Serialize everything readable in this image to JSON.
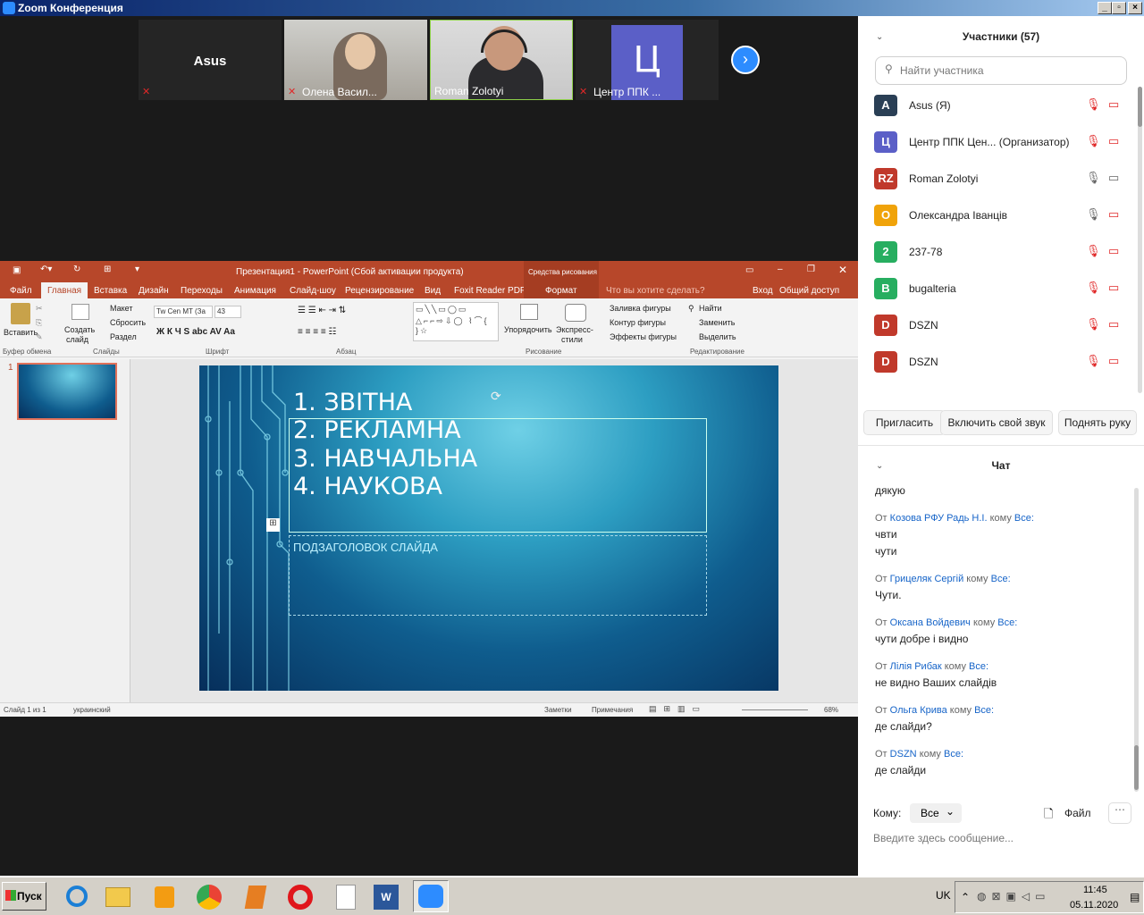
{
  "window": {
    "title": "Zoom Конференция"
  },
  "videos": [
    {
      "name": "Asus",
      "kind": "name-only"
    },
    {
      "name": "Олена Васил...",
      "kind": "camera"
    },
    {
      "name": "Roman Zolotyi",
      "kind": "camera"
    },
    {
      "name": "Центр ППК ...",
      "kind": "avatar",
      "avatar": "Ц"
    }
  ],
  "ppt": {
    "title": "Презентация1 - PowerPoint (Сбой активации продукта)",
    "context_tab": "Средства рисования",
    "tabs": [
      "Файл",
      "Главная",
      "Вставка",
      "Дизайн",
      "Переходы",
      "Анимация",
      "Слайд-шоу",
      "Рецензирование",
      "Вид",
      "Foxit Reader PDF",
      "Формат"
    ],
    "tell_me": "Что вы хотите сделать?",
    "signin": "Вход",
    "share": "Общий доступ",
    "ribbon": {
      "paste": "Вставить",
      "new_slide": "Создать",
      "new_slide2": "слайд",
      "layout": "Макет",
      "reset": "Сбросить",
      "section": "Раздел",
      "font_name": "Tw Cen MT (За",
      "font_size": "43",
      "arrange": "Упорядочить",
      "quick_styles": "Экспресс-",
      "quick_styles2": "стили",
      "fill": "Заливка фигуры",
      "outline": "Контур фигуры",
      "effects": "Эффекты фигуры",
      "find": "Найти",
      "replace": "Заменить",
      "select": "Выделить",
      "groups": [
        "Буфер обмена",
        "Слайды",
        "Шрифт",
        "Абзац",
        "Рисование",
        "Редактирование"
      ]
    },
    "slide_lines": [
      "1. ЗВІТНА",
      "2. РЕКЛАМНА",
      "3. НАВЧАЛЬНА",
      "4. НАУКОВА"
    ],
    "subtitle": "ПОДЗАГОЛОВОК СЛАЙДА",
    "thumb_num": "1",
    "status": {
      "slide": "Слайд 1 из 1",
      "lang": "украинский",
      "notes": "Заметки",
      "comments": "Примечания",
      "zoom": "68%"
    }
  },
  "participants": {
    "title": "Участники (57)",
    "search_placeholder": "Найти участника",
    "list": [
      {
        "avatar": "A",
        "color": "#2a3f55",
        "name": "Asus (Я)"
      },
      {
        "avatar": "Ц",
        "color": "#5b5fc7",
        "name": "Центр ППК Цен... (Организатор)"
      },
      {
        "avatar": "RZ",
        "color": "#c0392b",
        "name": "Roman Zolotyi"
      },
      {
        "avatar": "O",
        "color": "#f0a30a",
        "name": "Олександра Іванців"
      },
      {
        "avatar": "2",
        "color": "#27ae60",
        "name": "237-78"
      },
      {
        "avatar": "B",
        "color": "#27ae60",
        "name": "bugalteria"
      },
      {
        "avatar": "D",
        "color": "#c0392b",
        "name": "DSZN"
      },
      {
        "avatar": "D",
        "color": "#c0392b",
        "name": "DSZN"
      }
    ],
    "buttons": [
      "Пригласить",
      "Включить свой звук",
      "Поднять руку"
    ]
  },
  "chat": {
    "title": "Чат",
    "first": "дякую",
    "messages": [
      {
        "from": "Козова РФУ Радь Н.І.",
        "to": "Все:",
        "lines": [
          "чвти",
          "чути"
        ]
      },
      {
        "from": "Грицеляк Сергій",
        "to": "Все:",
        "lines": [
          "Чути."
        ]
      },
      {
        "from": "Оксана Войдевич",
        "to": "Все:",
        "lines": [
          "чути добре і видно"
        ]
      },
      {
        "from": "Лілія Рибак",
        "to": "Все:",
        "lines": [
          "не видно Ваших слайдів"
        ]
      },
      {
        "from": "Ольга Крива",
        "to": "Все:",
        "lines": [
          "де слайди?"
        ]
      },
      {
        "from": "DSZN",
        "to": "Все:",
        "lines": [
          "де слайди"
        ]
      }
    ],
    "from_label": "От",
    "to_label": "кому",
    "to_prefix": "Кому:",
    "to_value": "Все",
    "file": "Файл",
    "input_placeholder": "Введите здесь сообщение..."
  },
  "taskbar": {
    "start": "Пуск",
    "lang": "UK",
    "time": "11:45",
    "date": "05.11.2020"
  }
}
